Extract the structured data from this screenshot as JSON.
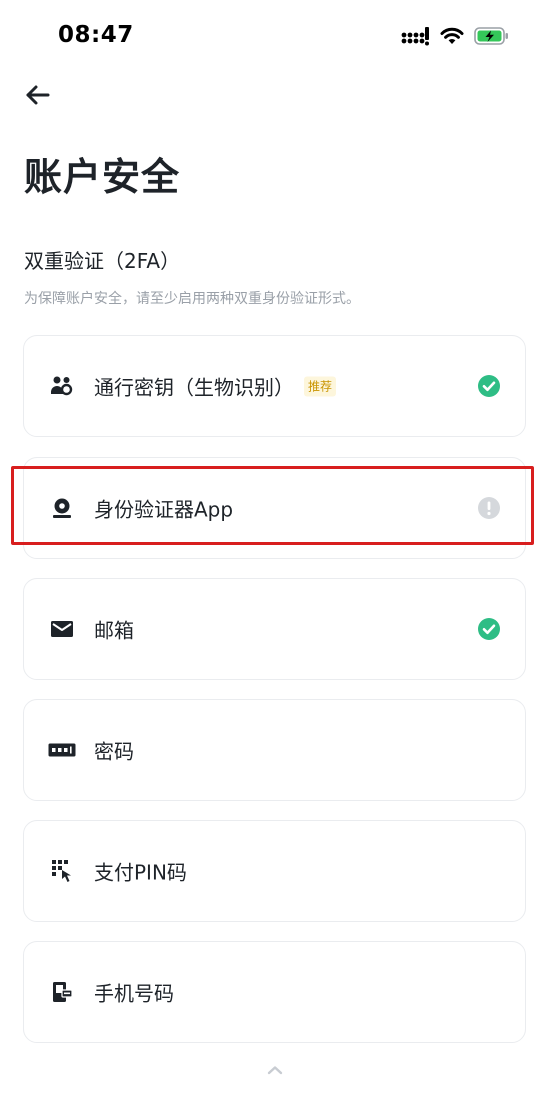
{
  "status_bar": {
    "time": "08:47",
    "icons": [
      "signal-icon",
      "wifi-icon",
      "battery-charging-icon"
    ]
  },
  "header": {
    "back_icon": "arrow-left-icon",
    "title": "账户安全"
  },
  "section": {
    "title": "双重验证（2FA）",
    "description": "为保障账户安全，请至少启用两种双重身份验证形式。"
  },
  "items": [
    {
      "label": "通行密钥（生物识别）",
      "badge": "推荐",
      "icon": "passkey-icon",
      "status": "enabled"
    },
    {
      "label": "身份验证器App",
      "badge": "",
      "icon": "authenticator-icon",
      "status": "warning"
    },
    {
      "label": "邮箱",
      "badge": "",
      "icon": "mail-icon",
      "status": "enabled"
    },
    {
      "label": "密码",
      "badge": "",
      "icon": "password-icon",
      "status": "none"
    },
    {
      "label": "支付PIN码",
      "badge": "",
      "icon": "pin-keypad-icon",
      "status": "none"
    },
    {
      "label": "手机号码",
      "badge": "",
      "icon": "phone-icon",
      "status": "none"
    }
  ],
  "colors": {
    "enabled": "#2ebd85",
    "warning": "#c8ccd2",
    "highlight": "#d81e1e",
    "badge_text": "#c99400",
    "badge_bg": "#fdf6dc"
  }
}
